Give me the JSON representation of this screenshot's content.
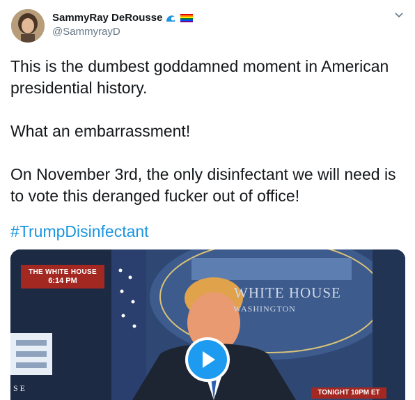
{
  "author": {
    "display_name": "SammyRay DeRousse",
    "handle": "@SammyrayD",
    "badges": [
      "wave-emoji",
      "rainbow-flag-emoji"
    ]
  },
  "tweet": {
    "paragraphs": [
      "This is the dumbest goddamned moment in American presidential history.",
      "What an embarrassment!",
      "On November 3rd, the only disinfectant we will need is to vote this deranged fucker out of office!"
    ],
    "hashtag": "#TrumpDisinfectant"
  },
  "video": {
    "top_banner_line1": "THE WHITE HOUSE",
    "top_banner_line2": "6:14 PM",
    "seal_line1": "WHITE HOUSE",
    "seal_line2": "WASHINGTON",
    "bottom_banner": "TONIGHT 10PM ET",
    "edge_text": "SE",
    "play_icon": "play-icon"
  },
  "colors": {
    "link": "#1b95e0",
    "text": "#14171a",
    "secondary": "#657786",
    "banner": "#a32822",
    "play": "#1d9bf0"
  }
}
